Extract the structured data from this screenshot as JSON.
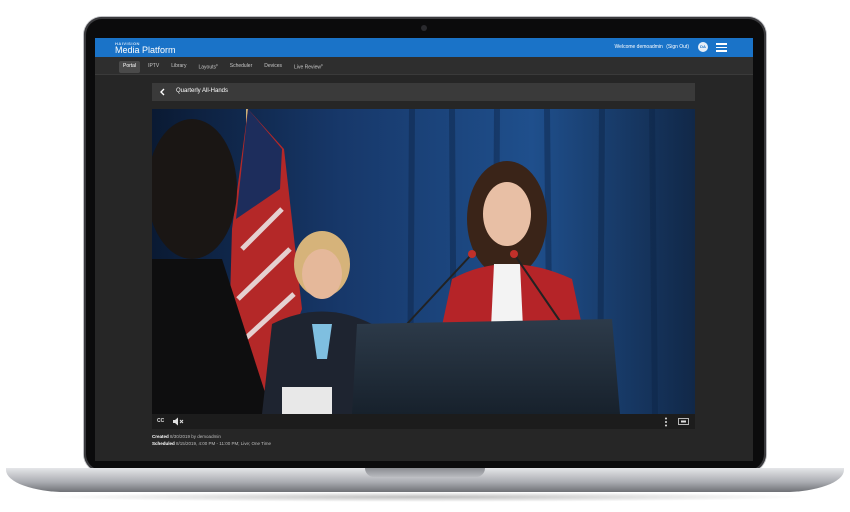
{
  "app": {
    "brand_small": "HAIVISION",
    "brand": "Media Platform",
    "welcome_text": "Welcome demoadmin",
    "sign_out": "(Sign Out)",
    "avatar_initials": "DA"
  },
  "nav": {
    "tabs": [
      {
        "label": "Portal",
        "active": true
      },
      {
        "label": "IPTV"
      },
      {
        "label": "Library"
      },
      {
        "label": "Layouts",
        "beta": "β"
      },
      {
        "label": "Scheduler"
      },
      {
        "label": "Devices"
      },
      {
        "label": "Live Review",
        "beta": "β"
      }
    ]
  },
  "player": {
    "title": "Quarterly All-Hands",
    "cc_label": "CC",
    "mute_icon": "mute-icon",
    "more_icon": "more-vertical-icon",
    "fullscreen_icon": "fullscreen-icon"
  },
  "meta": {
    "created_label": "Created",
    "created_value": "8/30/2019 by demoadmin",
    "scheduled_label": "Scheduled",
    "scheduled_value": "8/15/2019, 4:00 PM - 11:00 PM; Live; One Time"
  },
  "colors": {
    "topbar": "#1a73c8",
    "background": "#262626",
    "nav": "#2e2e2e"
  }
}
